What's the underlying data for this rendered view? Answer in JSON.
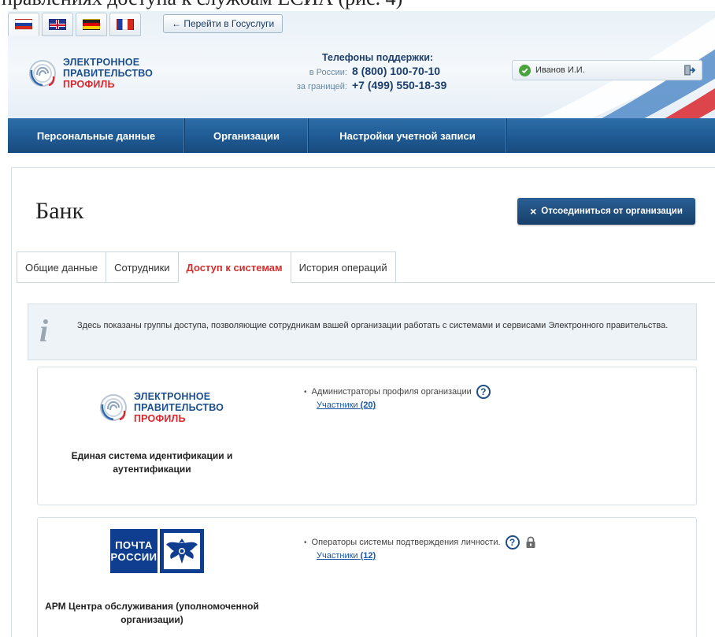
{
  "caption": "правлениях доступа к службам ЕСИА (рис. 4)",
  "header": {
    "languages": [
      {
        "name": "ru-flag-icon",
        "active": true
      },
      {
        "name": "uk-flag-icon",
        "active": false
      },
      {
        "name": "de-flag-icon",
        "active": false
      },
      {
        "name": "fr-flag-icon",
        "active": false
      }
    ],
    "gosuslugi_label": "← Перейти в Госуслуги",
    "logo": {
      "line1": "ЭЛЕКТРОННОЕ",
      "line2": "ПРАВИТЕЛЬСТВО",
      "line3": "ПРОФИЛЬ"
    },
    "support": {
      "title": "Телефоны поддержки:",
      "russia_label": "в России:",
      "russia_phone": "8 (800) 100-70-10",
      "abroad_label": "за границей:",
      "abroad_phone": "+7 (499) 550-18-39"
    },
    "user": {
      "name": "Иванов И.И."
    }
  },
  "nav": {
    "items": [
      {
        "label": "Персональные данные"
      },
      {
        "label": "Организации"
      },
      {
        "label": "Настройки учетной записи"
      }
    ]
  },
  "main": {
    "title": "Банк",
    "disconnect_label": "Отсоединиться от организации",
    "tabs": [
      {
        "label": "Общие данные",
        "active": false
      },
      {
        "label": "Сотрудники",
        "active": false
      },
      {
        "label": "Доступ к системам",
        "active": true
      },
      {
        "label": "История операций",
        "active": false
      }
    ],
    "info_text": "Здесь показаны группы доступа, позволяющие сотрудникам вашей организации работать с системами и сервисами Электронного правительства.",
    "systems": [
      {
        "title_line1": "Единая система идентификации и",
        "title_line2": "аутентификации",
        "logo": {
          "line1": "ЭЛЕКТРОННОЕ",
          "line2": "ПРАВИТЕЛЬСТВО",
          "line3": "ПРОФИЛЬ"
        },
        "group_name": "Администраторы профиля организации",
        "members_label": "Участники",
        "members_count": "(20)",
        "locked": false
      },
      {
        "title_line1": "АРМ Центра обслуживания (уполномоченной",
        "title_line2": "организации)",
        "logo_text_line1": "ПОЧТА",
        "logo_text_line2": "РОССИИ",
        "group_name": "Операторы системы подтверждения личности.",
        "members_label": "Участники",
        "members_count": "(12)",
        "locked": true
      }
    ]
  },
  "colors": {
    "nav_blue": "#1f5a93",
    "logo_blue": "#1b4f8f",
    "logo_red": "#d9272e",
    "active_tab_red": "#d32f2f",
    "link_blue": "#1a56a8",
    "post_blue": "#0f3d8f"
  }
}
